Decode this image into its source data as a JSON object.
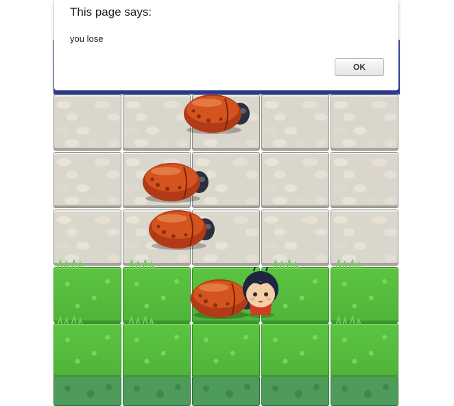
{
  "dialog": {
    "title": "This page says:",
    "message": "you lose",
    "ok_label": "OK"
  },
  "board": {
    "columns": 5,
    "rows": [
      "water",
      "stone",
      "stone",
      "stone",
      "grass",
      "grass"
    ],
    "enemies": [
      {
        "row": 1,
        "col": 2.0
      },
      {
        "row": 2,
        "col": 1.4
      },
      {
        "row": 3,
        "col": 1.5
      },
      {
        "row": 4,
        "col": 2.0
      }
    ],
    "player": {
      "row": 4,
      "col": 3,
      "character": "char-boy-icon"
    }
  },
  "colors": {
    "water": "#3f4fb0",
    "stone": "#d9d6cc",
    "grass": "#5bc441",
    "bug_shell": "#c1441c",
    "bug_head": "#2b2f3e"
  }
}
